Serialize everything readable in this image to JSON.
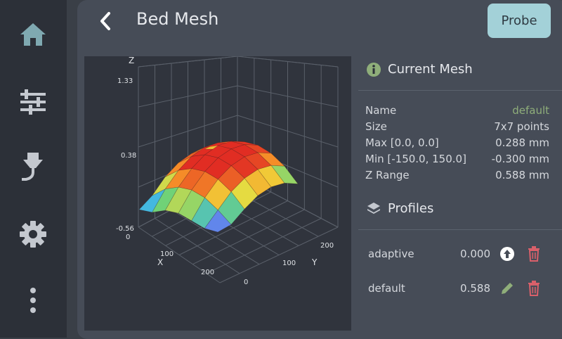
{
  "header": {
    "title": "Bed Mesh",
    "probe_label": "Probe"
  },
  "sidebar": {
    "items": [
      {
        "icon": "home-icon"
      },
      {
        "icon": "tune-icon"
      },
      {
        "icon": "extruder-icon"
      },
      {
        "icon": "gear-icon"
      },
      {
        "icon": "more-vertical-icon"
      }
    ]
  },
  "plot": {
    "z_axis_label": "Z",
    "z_ticks": [
      "1.33",
      "0.38",
      "-0.56"
    ],
    "x_axis_label": "X",
    "x_ticks": [
      "0",
      "100",
      "200"
    ],
    "y_axis_label": "Y",
    "y_ticks": [
      "200",
      "100",
      "0"
    ]
  },
  "current_mesh": {
    "title": "Current Mesh",
    "rows": [
      {
        "label": "Name",
        "value": "default"
      },
      {
        "label": "Size",
        "value": "7x7 points"
      },
      {
        "label": "Max [0.0, 0.0]",
        "value": "0.288 mm"
      },
      {
        "label": "Min [-150.0, 150.0]",
        "value": "-0.300 mm"
      },
      {
        "label": "Z Range",
        "value": "0.588 mm"
      }
    ]
  },
  "profiles": {
    "title": "Profiles",
    "items": [
      {
        "name": "adaptive",
        "value": "0.000",
        "action_icon": "upload-icon"
      },
      {
        "name": "default",
        "value": "0.588",
        "action_icon": "edit-icon"
      }
    ]
  },
  "colors": {
    "accent": "#a3d1d8",
    "delete": "#d9606a",
    "info": "#8fae7a"
  }
}
